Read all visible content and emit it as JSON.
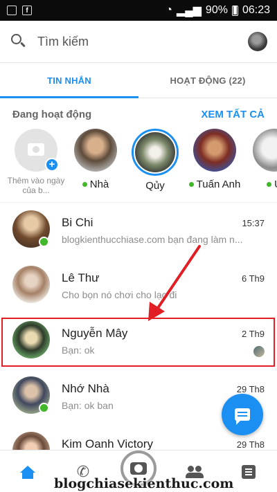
{
  "status_bar": {
    "battery": "90%",
    "time": "06:23"
  },
  "search": {
    "placeholder": "Tìm kiếm"
  },
  "tabs": [
    {
      "label": "TIN NHẮN",
      "active": true
    },
    {
      "label": "HOẠT ĐỘNG (22)",
      "active": false
    }
  ],
  "active_now": {
    "title": "Đang hoạt động",
    "see_all": "XEM TẤT CẢ",
    "add_story_label": "Thêm vào ngày của b...",
    "people": [
      {
        "name": "Nhà",
        "online": true
      },
      {
        "name": "Qủy",
        "online": false
      },
      {
        "name": "Tuấn Anh",
        "online": true
      },
      {
        "name": "Ú",
        "online": true
      }
    ]
  },
  "conversations": [
    {
      "name": "Bi Chi",
      "message": "blogkienthucchiase.com bạn đang làm n...",
      "time": "15:37",
      "online": true
    },
    {
      "name": "Lê Thư",
      "message": "Cho bọn nó chơi cho lạc đi",
      "time": "6 Th9",
      "online": false
    },
    {
      "name": "Nguyễn Mây",
      "message": "Bạn: ok",
      "time": "2 Th9",
      "online": false
    },
    {
      "name": "Nhớ Nhà",
      "message": "Bạn: ok ban",
      "time": "29 Th8",
      "online": true
    },
    {
      "name": "Kim Oanh Victory",
      "message": "",
      "time": "29 Th8",
      "online": false
    }
  ],
  "watermark": "blogchiasekienthuc.com",
  "colors": {
    "accent": "#1b8ff2",
    "online": "#42b72a",
    "highlight": "#e01e24"
  },
  "icons": {
    "search": "search-icon",
    "compose": "compose-icon",
    "home": "home-icon",
    "calls": "phone-icon",
    "camera": "camera-icon",
    "people": "people-icon",
    "list": "list-icon"
  }
}
